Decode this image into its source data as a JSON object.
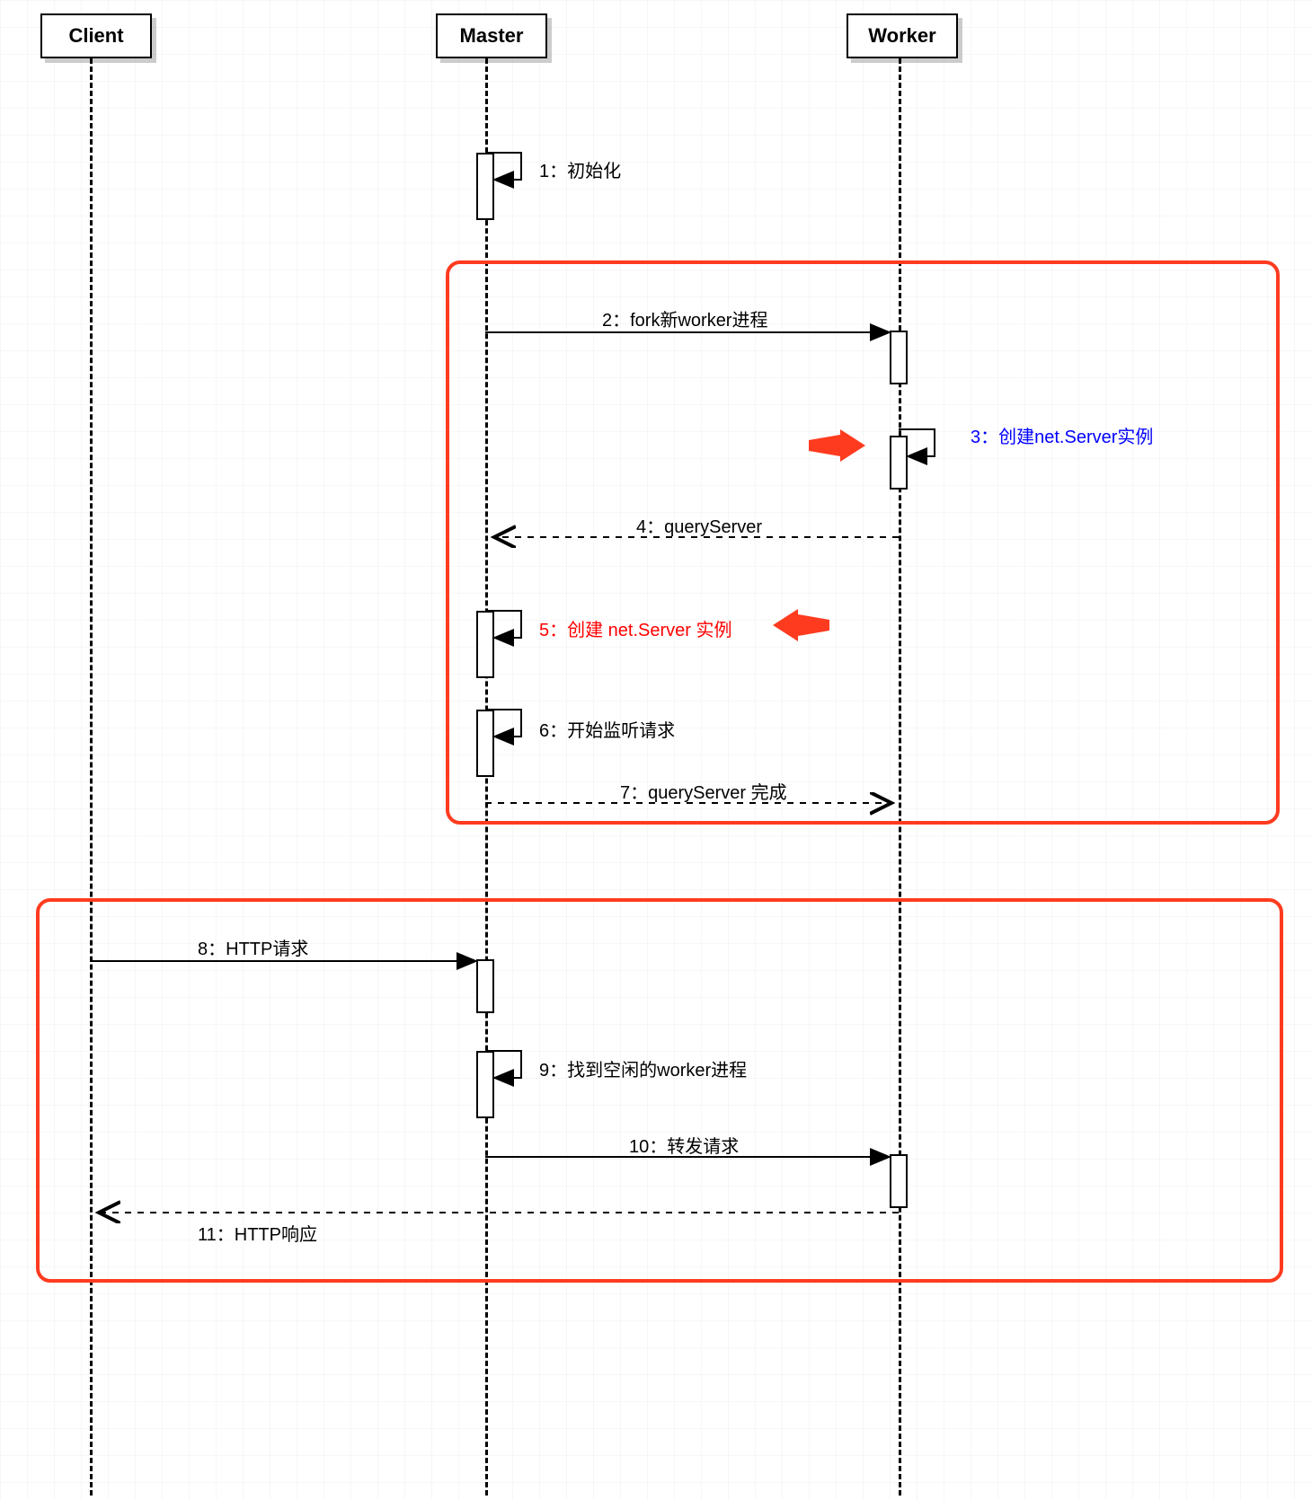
{
  "participants": {
    "client": "Client",
    "master": "Master",
    "worker": "Worker"
  },
  "messages": {
    "m1": "1：初始化",
    "m2": "2：fork新worker进程",
    "m3": "3：创建net.Server实例",
    "m4": "4：queryServer",
    "m5": "5：创建 net.Server 实例",
    "m6": "6：开始监听请求",
    "m7": "7：queryServer 完成",
    "m8": "8：HTTP请求",
    "m9": "9：找到空闲的worker进程",
    "m10": "10：转发请求",
    "m11": "11：HTTP响应"
  },
  "diagram_type": "sequence",
  "highlight_regions": [
    "fork-and-setup",
    "http-request-handling"
  ]
}
